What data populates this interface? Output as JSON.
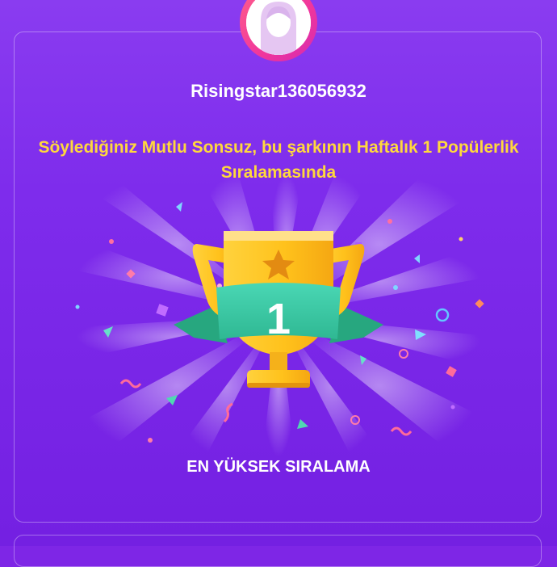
{
  "profile": {
    "username": "Risingstar136056932"
  },
  "achievement": {
    "message": "Söylediğiniz Mutlu Sonsuz, bu şarkının Haftalık 1 Popülerlik Sıralamasında",
    "rank": "1",
    "label": "EN YÜKSEK SIRALAMA"
  },
  "icons": {
    "avatar": "user-avatar-icon",
    "trophy": "trophy-icon",
    "star": "star-icon"
  },
  "colors": {
    "background": "#7e26e6",
    "message_text": "#ffd83d",
    "trophy_gold": "#f9c425",
    "ribbon_teal": "#3cc8a6",
    "avatar_ring": "#f0369c"
  }
}
